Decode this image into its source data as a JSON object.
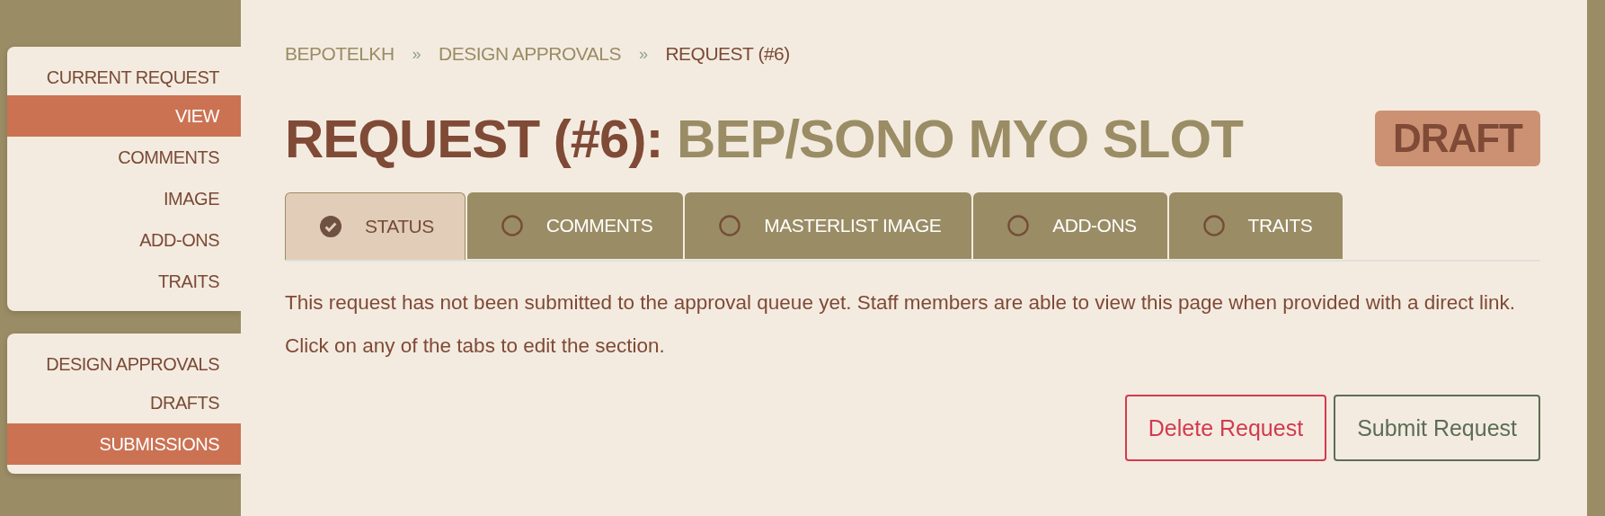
{
  "sidebar": [
    {
      "heading": "CURRENT REQUEST",
      "items": [
        {
          "label": "VIEW",
          "selected": true
        },
        {
          "label": "COMMENTS",
          "selected": false
        },
        {
          "label": "IMAGE",
          "selected": false
        },
        {
          "label": "ADD-ONS",
          "selected": false
        },
        {
          "label": "TRAITS",
          "selected": false
        }
      ]
    },
    {
      "heading": "DESIGN APPROVALS",
      "items": [
        {
          "label": "DRAFTS",
          "selected": false
        },
        {
          "label": "SUBMISSIONS",
          "selected": true
        }
      ]
    }
  ],
  "breadcrumbs": [
    {
      "label": "BEPOTELKH",
      "current": false
    },
    {
      "label": "»",
      "kind": "separator"
    },
    {
      "label": "DESIGN APPROVALS",
      "current": false
    },
    {
      "label": "»",
      "kind": "separator"
    },
    {
      "label": "REQUEST (#6)",
      "current": true
    }
  ],
  "title": {
    "prefix": "REQUEST (#6):",
    "name": "BEP/SONO MYO SLOT"
  },
  "status_badge": "DRAFT",
  "tabs": [
    {
      "label": "STATUS",
      "selected": true,
      "done": true
    },
    {
      "label": "COMMENTS",
      "selected": false,
      "done": false
    },
    {
      "label": "MASTERLIST IMAGE",
      "selected": false,
      "done": false
    },
    {
      "label": "ADD-ONS",
      "selected": false,
      "done": false
    },
    {
      "label": "TRAITS",
      "selected": false,
      "done": false
    }
  ],
  "message": "This request has not been submitted to the approval queue yet. Staff members are able to view this page when provided with a direct link. Click on any of the tabs to edit the section.",
  "buttons": [
    {
      "label": "Delete Request",
      "kind": "danger"
    },
    {
      "label": "Submit Request",
      "kind": "primary"
    }
  ]
}
